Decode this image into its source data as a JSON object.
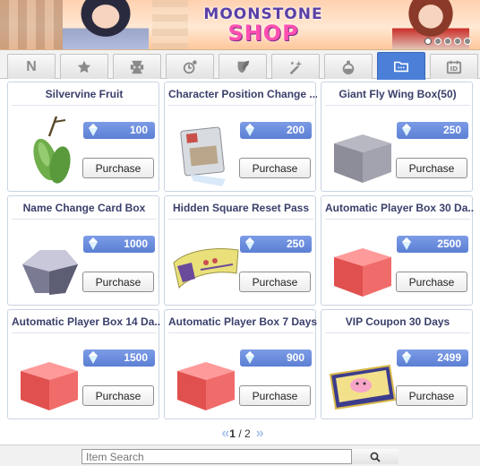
{
  "banner": {
    "title_line1": "MOONSTONE",
    "title_line2": "SHOP",
    "page_dots": 5,
    "active_dot": 1
  },
  "tabs": [
    {
      "id": "new",
      "label": "N",
      "icon": "n-letter-icon"
    },
    {
      "id": "favorites",
      "icon": "star-icon"
    },
    {
      "id": "rental",
      "icon": "hourglass-icon"
    },
    {
      "id": "time-limited",
      "icon": "clock-potion-icon"
    },
    {
      "id": "equipment",
      "icon": "shield-sword-icon"
    },
    {
      "id": "enhancement",
      "icon": "sparkle-wand-icon"
    },
    {
      "id": "consumables",
      "icon": "potion-icon"
    },
    {
      "id": "boxes",
      "icon": "folder-icon",
      "active": true
    },
    {
      "id": "cards",
      "icon": "id-card-icon"
    }
  ],
  "items": [
    {
      "name": "Silvervine Fruit",
      "price": "100",
      "button": "Purchase",
      "icon": "silvervine-fruit-icon"
    },
    {
      "name": "Character Position Change ...",
      "price": "200",
      "button": "Purchase",
      "icon": "position-change-card-icon"
    },
    {
      "name": "Giant Fly Wing Box(50)",
      "price": "250",
      "button": "Purchase",
      "icon": "gray-box-icon"
    },
    {
      "name": "Name Change Card Box",
      "price": "1000",
      "button": "Purchase",
      "icon": "silver-box-icon"
    },
    {
      "name": "Hidden Square Reset Pass",
      "price": "250",
      "button": "Purchase",
      "icon": "reset-pass-ticket-icon"
    },
    {
      "name": "Automatic Player Box 30 Da...",
      "price": "2500",
      "button": "Purchase",
      "icon": "red-box-icon"
    },
    {
      "name": "Automatic Player Box 14 Da...",
      "price": "1500",
      "button": "Purchase",
      "icon": "red-box-icon"
    },
    {
      "name": "Automatic Player Box 7 Days",
      "price": "900",
      "button": "Purchase",
      "icon": "red-box-icon"
    },
    {
      "name": "VIP Coupon 30 Days",
      "price": "2499",
      "button": "Purchase",
      "icon": "vip-coupon-icon"
    }
  ],
  "pagination": {
    "current": "1",
    "separator": " / ",
    "total": "2",
    "prev_label": "«",
    "next_label": "»"
  },
  "search": {
    "placeholder": "Item Search"
  },
  "colors": {
    "accent": "#4b7fd8",
    "price_bg": "#6b8ddc",
    "title_text": "#3a3f6b"
  }
}
